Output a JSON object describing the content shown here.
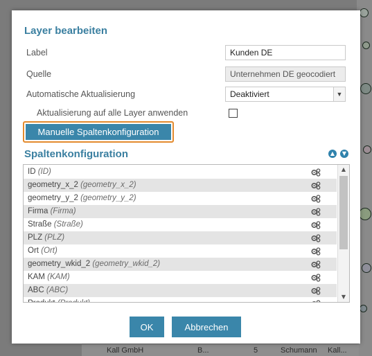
{
  "dialog": {
    "title": "Layer bearbeiten",
    "fields": {
      "label_label": "Label",
      "label_value": "Kunden DE",
      "source_label": "Quelle",
      "source_value": "Unternehmen DE geocodiert",
      "autoupdate_label": "Automatische Aktualisierung",
      "autoupdate_value": "Deaktiviert",
      "apply_all_label": "Aktualisierung auf alle Layer anwenden",
      "apply_all_checked": false
    },
    "manual_button_label": "Manuelle Spaltenkonfiguration",
    "columns_title": "Spaltenkonfiguration",
    "columns": [
      {
        "name": "ID",
        "alias": "(ID)"
      },
      {
        "name": "geometry_x_2",
        "alias": "(geometry_x_2)"
      },
      {
        "name": "geometry_y_2",
        "alias": "(geometry_y_2)"
      },
      {
        "name": "Firma",
        "alias": "(Firma)"
      },
      {
        "name": "Straße",
        "alias": "(Straße)"
      },
      {
        "name": "PLZ",
        "alias": "(PLZ)"
      },
      {
        "name": "Ort",
        "alias": "(Ort)"
      },
      {
        "name": "geometry_wkid_2",
        "alias": "(geometry_wkid_2)"
      },
      {
        "name": "KAM",
        "alias": "(KAM)"
      },
      {
        "name": "ABC",
        "alias": "(ABC)"
      },
      {
        "name": "Produkt",
        "alias": "(Produkt)"
      }
    ],
    "ok_label": "OK",
    "cancel_label": "Abbrechen"
  },
  "background": {
    "table_cells": [
      "Kall GmbH",
      "B...",
      "5",
      "Schumann",
      "Kall..."
    ]
  },
  "colors": {
    "accent": "#3a86aa",
    "title": "#3a7fa0",
    "highlight": "#e38a2d"
  },
  "icons": {
    "row_action": "gears-icon",
    "move_up": "arrow-up-circle-icon",
    "move_down": "arrow-down-circle-icon",
    "select": "chevron-down-icon"
  }
}
